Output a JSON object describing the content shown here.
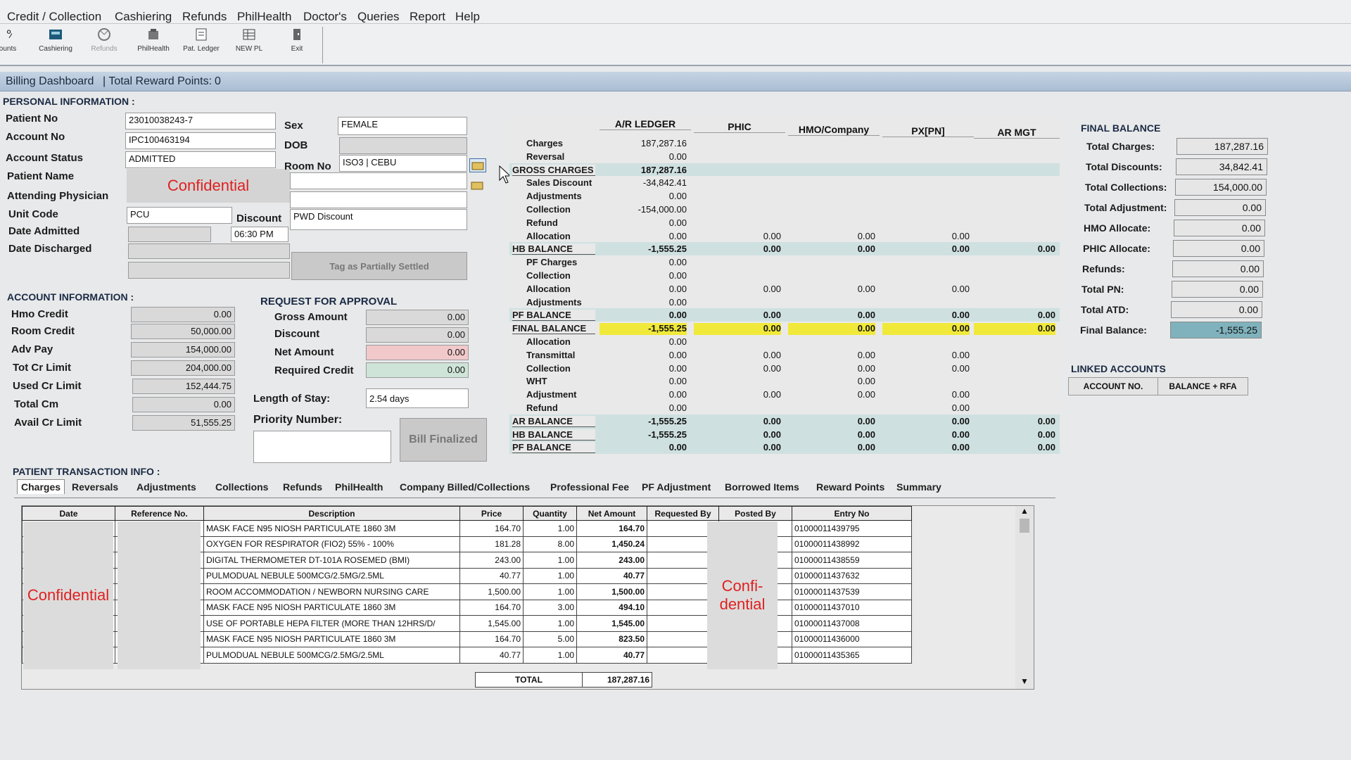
{
  "menu": [
    "Credit / Collection",
    "Cashiering",
    "Refunds",
    "PhilHealth",
    "Doctor's",
    "Queries",
    "Report",
    "Help"
  ],
  "toolbar": [
    {
      "label": "ccounts",
      "icon": "percent-icon"
    },
    {
      "label": "Cashiering",
      "icon": "cash-register-icon"
    },
    {
      "label": "Refunds",
      "icon": "refund-icon"
    },
    {
      "label": "PhilHealth",
      "icon": "philhealth-icon"
    },
    {
      "label": "Pat. Ledger",
      "icon": "ledger-icon"
    },
    {
      "label": "NEW PL",
      "icon": "new-pl-icon"
    },
    {
      "label": "Exit",
      "icon": "exit-door-icon"
    }
  ],
  "dashboard": {
    "title": "Billing Dashboard",
    "reward": "| Total Reward Points:",
    "reward_value": "0"
  },
  "personal": {
    "section": "PERSONAL INFORMATION :",
    "labels": {
      "patient_no": "Patient No",
      "account_no": "Account No",
      "account_status": "Account Status",
      "patient_name": "Patient Name",
      "attending": "Attending Physician",
      "unit_code": "Unit Code",
      "date_admitted": "Date Admitted",
      "date_discharged": "Date Discharged",
      "sex": "Sex",
      "dob": "DOB",
      "room_no": "Room No",
      "discount": "Discount"
    },
    "values": {
      "patient_no": "23010038243-7",
      "account_no": "IPC100463194",
      "account_status": "ADMITTED",
      "patient_name": "Confidential",
      "unit_code": "PCU",
      "time_admitted": "06:30 PM",
      "sex": "FEMALE",
      "room_no": "ISO3 | CEBU",
      "discount": "PWD Discount"
    },
    "tag_button": "Tag as Partially Settled"
  },
  "account": {
    "section": "ACCOUNT INFORMATION :",
    "rows": [
      {
        "label": "Hmo Credit",
        "value": "0.00"
      },
      {
        "label": "Room Credit",
        "value": "50,000.00"
      },
      {
        "label": "Adv Pay",
        "value": "154,000.00"
      },
      {
        "label": "Tot Cr Limit",
        "value": "204,000.00"
      },
      {
        "label": "Used Cr Limit",
        "value": "152,444.75"
      },
      {
        "label": "Total Cm",
        "value": "0.00"
      },
      {
        "label": "Avail Cr Limit",
        "value": "51,555.25"
      }
    ]
  },
  "approval": {
    "section": "REQUEST FOR APPROVAL",
    "rows": [
      {
        "label": "Gross Amount",
        "value": "0.00"
      },
      {
        "label": "Discount",
        "value": "0.00"
      },
      {
        "label": "Net Amount",
        "value": "0.00"
      },
      {
        "label": "Required Credit",
        "value": "0.00"
      }
    ],
    "los_label": "Length of Stay:",
    "los_value": "2.54 days",
    "priority_label": "Priority Number:",
    "bill_button": "Bill Finalized"
  },
  "ledger": {
    "columns": [
      "A/R LEDGER",
      "PHIC",
      "HMO/Company",
      "PX[PN]",
      "AR MGT"
    ],
    "rows": [
      {
        "label": "Charges",
        "vals": [
          "187,287.16",
          "",
          "",
          "",
          ""
        ]
      },
      {
        "label": "Reversal",
        "vals": [
          "0.00",
          "",
          "",
          "",
          ""
        ]
      },
      {
        "label": "GROSS CHARGES",
        "vals": [
          "187,287.16",
          "",
          "",
          "",
          ""
        ],
        "kind": "total"
      },
      {
        "label": "Sales Discount",
        "vals": [
          "-34,842.41",
          "",
          "",
          "",
          ""
        ]
      },
      {
        "label": "Adjustments",
        "vals": [
          "0.00",
          "",
          "",
          "",
          ""
        ]
      },
      {
        "label": "Collection",
        "vals": [
          "-154,000.00",
          "",
          "",
          "",
          ""
        ]
      },
      {
        "label": "Refund",
        "vals": [
          "0.00",
          "",
          "",
          "",
          ""
        ]
      },
      {
        "label": "Allocation",
        "vals": [
          "0.00",
          "0.00",
          "0.00",
          "0.00",
          ""
        ]
      },
      {
        "label": "HB BALANCE",
        "vals": [
          "-1,555.25",
          "0.00",
          "0.00",
          "0.00",
          "0.00"
        ],
        "kind": "total"
      },
      {
        "label": "PF Charges",
        "vals": [
          "0.00",
          "",
          "",
          "",
          ""
        ]
      },
      {
        "label": "Collection",
        "vals": [
          "0.00",
          "",
          "",
          "",
          ""
        ]
      },
      {
        "label": "Allocation",
        "vals": [
          "0.00",
          "0.00",
          "0.00",
          "0.00",
          ""
        ]
      },
      {
        "label": "Adjustments",
        "vals": [
          "0.00",
          "",
          "",
          "",
          ""
        ]
      },
      {
        "label": "PF BALANCE",
        "vals": [
          "0.00",
          "0.00",
          "0.00",
          "0.00",
          "0.00"
        ],
        "kind": "total"
      },
      {
        "label": "FINAL BALANCE",
        "vals": [
          "-1,555.25",
          "0.00",
          "0.00",
          "0.00",
          "0.00"
        ],
        "kind": "final"
      },
      {
        "label": "Allocation",
        "vals": [
          "0.00",
          "",
          "",
          "",
          ""
        ]
      },
      {
        "label": "Transmittal",
        "vals": [
          "0.00",
          "0.00",
          "0.00",
          "0.00",
          ""
        ]
      },
      {
        "label": "Collection",
        "vals": [
          "0.00",
          "0.00",
          "0.00",
          "0.00",
          ""
        ]
      },
      {
        "label": "WHT",
        "vals": [
          "0.00",
          "",
          "0.00",
          "",
          ""
        ]
      },
      {
        "label": "Adjustment",
        "vals": [
          "0.00",
          "0.00",
          "0.00",
          "0.00",
          ""
        ]
      },
      {
        "label": "Refund",
        "vals": [
          "0.00",
          "",
          "",
          "0.00",
          ""
        ]
      },
      {
        "label": "AR BALANCE",
        "vals": [
          "-1,555.25",
          "0.00",
          "0.00",
          "0.00",
          "0.00"
        ],
        "kind": "total"
      },
      {
        "label": "HB BALANCE",
        "vals": [
          "-1,555.25",
          "0.00",
          "0.00",
          "0.00",
          "0.00"
        ],
        "kind": "total"
      },
      {
        "label": "PF BALANCE",
        "vals": [
          "0.00",
          "0.00",
          "0.00",
          "0.00",
          "0.00"
        ],
        "kind": "total"
      }
    ]
  },
  "final_balance": {
    "section": "FINAL BALANCE",
    "rows": [
      {
        "label": "Total Charges:",
        "value": "187,287.16"
      },
      {
        "label": "Total Discounts:",
        "value": "34,842.41"
      },
      {
        "label": "Total Collections:",
        "value": "154,000.00"
      },
      {
        "label": "Total Adjustment:",
        "value": "0.00"
      },
      {
        "label": "HMO Allocate:",
        "value": "0.00"
      },
      {
        "label": "PHIC Allocate:",
        "value": "0.00"
      },
      {
        "label": "Refunds:",
        "value": "0.00"
      },
      {
        "label": "Total PN:",
        "value": "0.00"
      },
      {
        "label": "Total ATD:",
        "value": "0.00"
      },
      {
        "label": "Final Balance:",
        "value": "-1,555.25"
      }
    ],
    "linked_section": "LINKED ACCOUNTS",
    "linked_cols": [
      "ACCOUNT NO.",
      "BALANCE + RFA"
    ]
  },
  "transactions": {
    "section": "PATIENT TRANSACTION INFO :",
    "tabs": [
      "Charges",
      "Reversals",
      "Adjustments",
      "Collections",
      "Refunds",
      "PhilHealth",
      "Company Billed/Collections",
      "Professional Fee",
      "PF Adjustment",
      "Borrowed Items",
      "Reward Points",
      "Summary"
    ],
    "columns": [
      "Date",
      "Reference No.",
      "Description",
      "Price",
      "Quantity",
      "Net Amount",
      "Requested By",
      "Posted By",
      "Entry No"
    ],
    "rows": [
      {
        "desc": "MASK FACE N95 NIOSH PARTICULATE 1860 3M",
        "price": "164.70",
        "qty": "1.00",
        "net": "164.70",
        "entry": "01000011439795"
      },
      {
        "desc": "OXYGEN FOR RESPIRATOR (FIO2) 55% - 100%",
        "price": "181.28",
        "qty": "8.00",
        "net": "1,450.24",
        "entry": "01000011438992"
      },
      {
        "desc": "DIGITAL THERMOMETER DT-101A ROSEMED (BMI)",
        "price": "243.00",
        "qty": "1.00",
        "net": "243.00",
        "entry": "01000011438559"
      },
      {
        "desc": "PULMODUAL NEBULE 500MCG/2.5MG/2.5ML",
        "price": "40.77",
        "qty": "1.00",
        "net": "40.77",
        "entry": "01000011437632"
      },
      {
        "desc": "ROOM ACCOMMODATION / NEWBORN NURSING CARE",
        "price": "1,500.00",
        "qty": "1.00",
        "net": "1,500.00",
        "entry": "01000011437539"
      },
      {
        "desc": "MASK FACE N95 NIOSH PARTICULATE 1860 3M",
        "price": "164.70",
        "qty": "3.00",
        "net": "494.10",
        "entry": "01000011437010"
      },
      {
        "desc": "USE OF PORTABLE HEPA FILTER (MORE THAN 12HRS/D/",
        "price": "1,545.00",
        "qty": "1.00",
        "net": "1,545.00",
        "entry": "01000011437008"
      },
      {
        "desc": "MASK FACE N95 NIOSH PARTICULATE 1860 3M",
        "price": "164.70",
        "qty": "5.00",
        "net": "823.50",
        "entry": "01000011436000"
      },
      {
        "desc": "PULMODUAL NEBULE 500MCG/2.5MG/2.5ML",
        "price": "40.77",
        "qty": "1.00",
        "net": "40.77",
        "entry": "01000011435365"
      }
    ],
    "total_label": "TOTAL",
    "total_value": "187,287.16",
    "redact_left": "Confidential",
    "redact_right": "Confi-\ndential"
  }
}
